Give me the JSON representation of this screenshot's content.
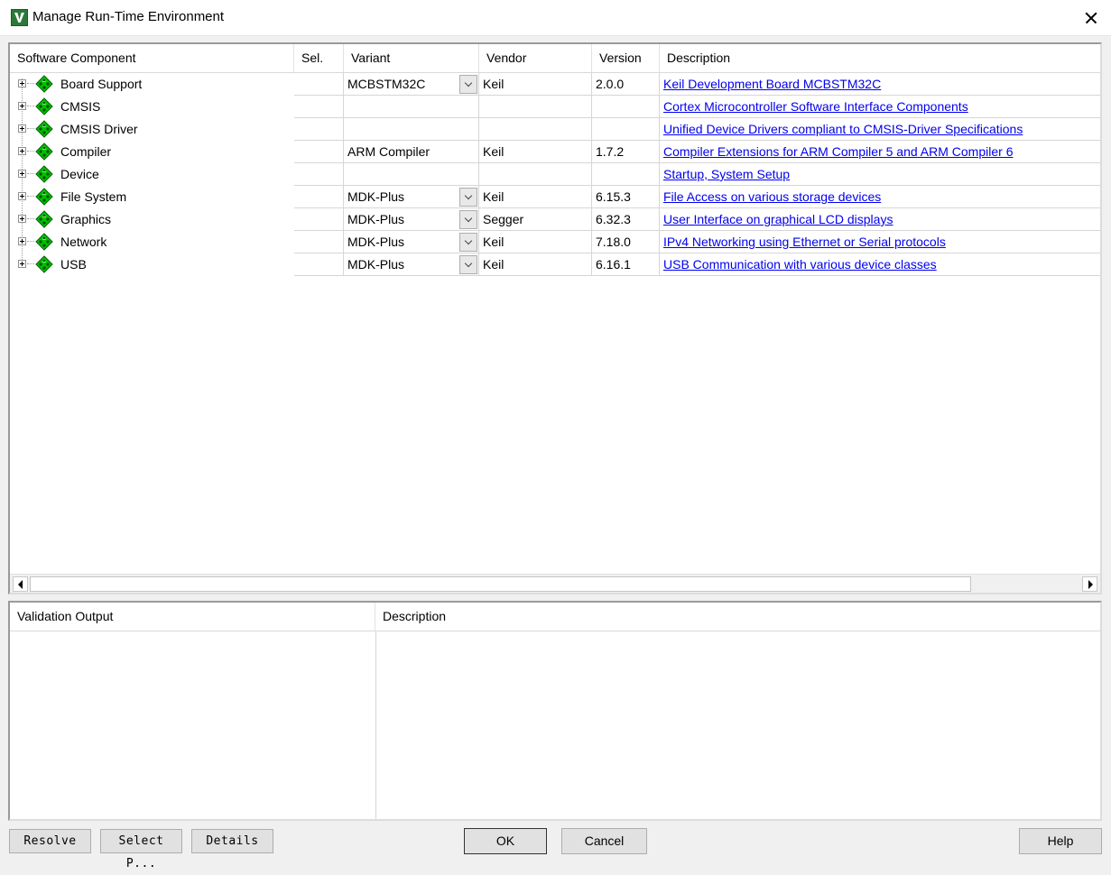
{
  "window": {
    "title": "Manage Run-Time Environment"
  },
  "components_table": {
    "headers": {
      "component": "Software Component",
      "sel": "Sel.",
      "variant": "Variant",
      "vendor": "Vendor",
      "version": "Version",
      "description": "Description"
    },
    "rows": [
      {
        "name": "Board Support",
        "sel": "",
        "variant": "MCBSTM32C",
        "has_dropdown": true,
        "vendor": "Keil",
        "version": "2.0.0",
        "description": "Keil Development Board MCBSTM32C"
      },
      {
        "name": "CMSIS",
        "sel": "",
        "variant": "",
        "has_dropdown": false,
        "vendor": "",
        "version": "",
        "description": "Cortex Microcontroller Software Interface Components"
      },
      {
        "name": "CMSIS Driver",
        "sel": "",
        "variant": "",
        "has_dropdown": false,
        "vendor": "",
        "version": "",
        "description": "Unified Device Drivers compliant to CMSIS-Driver Specifications"
      },
      {
        "name": "Compiler",
        "sel": "",
        "variant": "ARM Compiler",
        "has_dropdown": false,
        "vendor": "Keil",
        "version": "1.7.2",
        "description": "Compiler Extensions for ARM Compiler 5 and ARM Compiler 6"
      },
      {
        "name": "Device",
        "sel": "",
        "variant": "",
        "has_dropdown": false,
        "vendor": "",
        "version": "",
        "description": "Startup, System Setup"
      },
      {
        "name": "File System",
        "sel": "",
        "variant": "MDK-Plus",
        "has_dropdown": true,
        "vendor": "Keil",
        "version": "6.15.3",
        "description": "File Access on various storage devices"
      },
      {
        "name": "Graphics",
        "sel": "",
        "variant": "MDK-Plus",
        "has_dropdown": true,
        "vendor": "Segger",
        "version": "6.32.3",
        "description": "User Interface on graphical LCD displays"
      },
      {
        "name": "Network",
        "sel": "",
        "variant": "MDK-Plus",
        "has_dropdown": true,
        "vendor": "Keil",
        "version": "7.18.0",
        "description": "IPv4 Networking using Ethernet or Serial protocols"
      },
      {
        "name": "USB",
        "sel": "",
        "variant": "MDK-Plus",
        "has_dropdown": true,
        "vendor": "Keil",
        "version": "6.16.1",
        "description": "USB Communication with various device classes"
      }
    ]
  },
  "validation_table": {
    "headers": {
      "output": "Validation Output",
      "description": "Description"
    }
  },
  "buttons": {
    "resolve": "Resolve",
    "select_packs": "Select P...",
    "details": "Details",
    "ok": "OK",
    "cancel": "Cancel",
    "help": "Help"
  },
  "colors": {
    "link": "#0000ee",
    "component_icon": "#00c000"
  }
}
